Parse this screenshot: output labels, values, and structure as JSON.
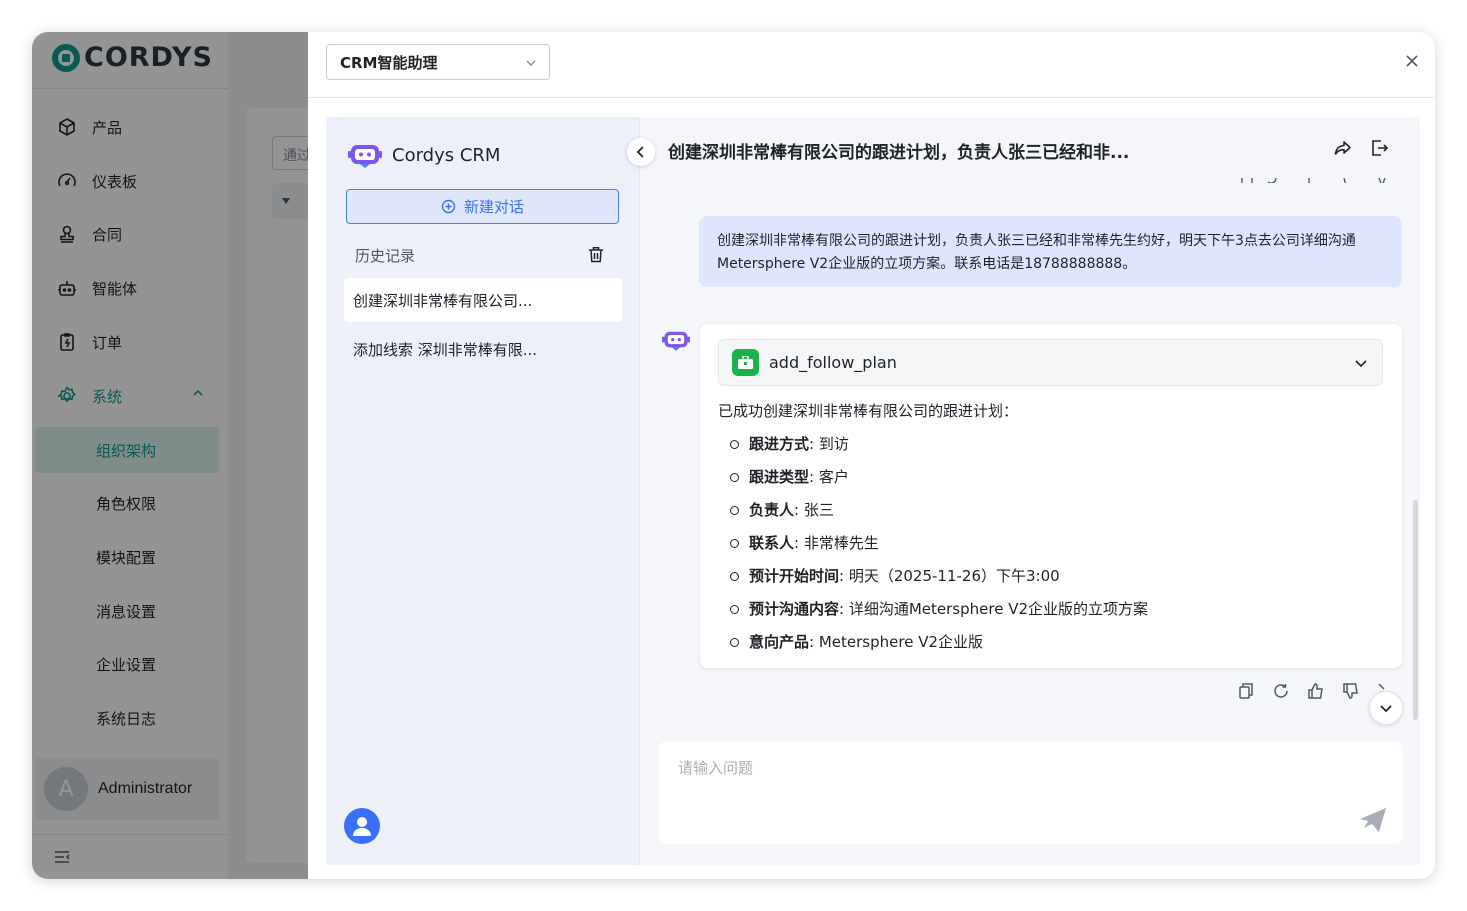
{
  "app": {
    "logo_text": "CORDYS",
    "nav": [
      {
        "label": "产品",
        "icon": "cube-icon"
      },
      {
        "label": "仪表板",
        "icon": "gauge-icon"
      },
      {
        "label": "合同",
        "icon": "stamp-icon"
      },
      {
        "label": "智能体",
        "icon": "robot-icon"
      },
      {
        "label": "订单",
        "icon": "order-icon"
      },
      {
        "label": "系统",
        "icon": "gear-icon"
      }
    ],
    "system_sub": [
      "组织架构",
      "角色权限",
      "模块配置",
      "消息设置",
      "企业设置",
      "系统日志"
    ],
    "selected_sub": "组织架构",
    "user": {
      "initial": "A",
      "name": "Administrator"
    },
    "search_placeholder": "通过"
  },
  "drawer": {
    "agent_select": "CRM智能助理",
    "brand": "Cordys CRM",
    "new_chat_label": "新建对话",
    "history_title": "历史记录",
    "history": [
      "创建深圳非常棒有限公司...",
      "添加线索 深圳非常棒有限..."
    ],
    "conversation_title": "创建深圳非常棒有限公司的跟进计划，负责人张三已经和非...",
    "user_message": "创建深圳非常棒有限公司的跟进计划，负责人张三已经和非常棒先生约好，明天下午3点去公司详细沟通Metersphere V2企业版的立项方案。联系电话是18788888888。",
    "tool_name": "add_follow_plan",
    "result_intro": "已成功创建深圳非常棒有限公司的跟进计划：",
    "results": [
      {
        "key": "跟进方式",
        "value": ": 到访"
      },
      {
        "key": "跟进类型",
        "value": ": 客户"
      },
      {
        "key": "负责人",
        "value": ": 张三"
      },
      {
        "key": "联系人",
        "value": ": 非常棒先生"
      },
      {
        "key": "预计开始时间",
        "value": ": 明天（2025-11-26）下午3:00"
      },
      {
        "key": "预计沟通内容",
        "value": ": 详细沟通Metersphere V2企业版的立项方案"
      },
      {
        "key": "意向产品",
        "value": ": Metersphere V2企业版"
      }
    ],
    "input_placeholder": "请输入问题"
  }
}
